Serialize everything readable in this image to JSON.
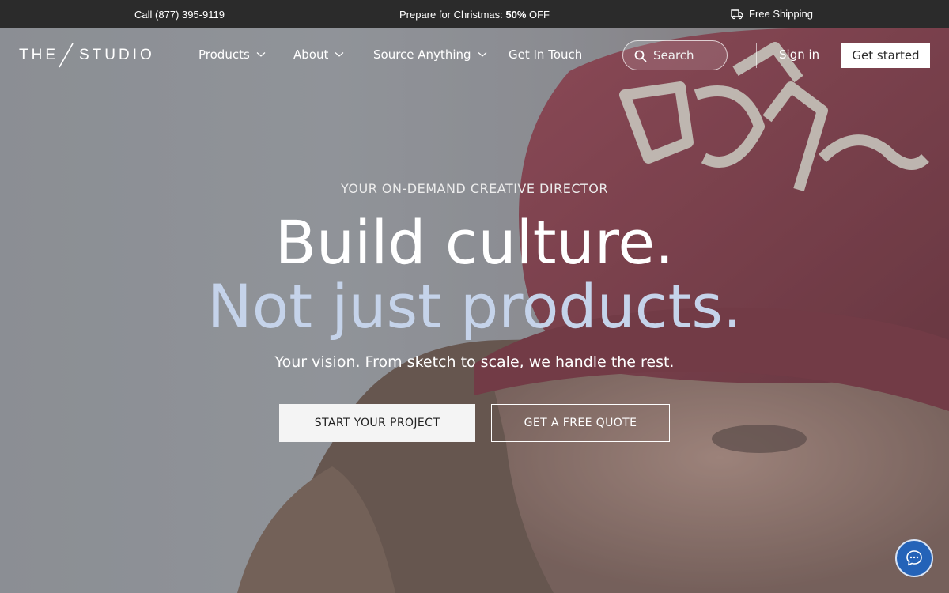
{
  "topbar": {
    "phone": "Call (877) 395-9119",
    "promo_prefix": "Prepare for Christmas: ",
    "promo_highlight": "50%",
    "promo_suffix": " OFF",
    "shipping": "Free Shipping",
    "shipping_icon": "truck-icon"
  },
  "header": {
    "logo_left": "THE",
    "logo_right": "STUDIO",
    "nav": [
      {
        "label": "Products",
        "dropdown": true
      },
      {
        "label": "About",
        "dropdown": true
      },
      {
        "label": "Source Anything",
        "dropdown": true
      },
      {
        "label": "Get In Touch",
        "dropdown": false
      }
    ],
    "search_placeholder": "Search",
    "sign_in": "Sign in",
    "get_started": "Get started"
  },
  "hero": {
    "eyebrow": "YOUR ON-DEMAND CREATIVE DIRECTOR",
    "headline_line1": "Build culture.",
    "headline_line2": "Not just products.",
    "subtitle": "Your vision. From sketch to scale, we handle the rest.",
    "cta_primary": "START YOUR PROJECT",
    "cta_secondary": "GET A FREE QUOTE"
  },
  "colors": {
    "topbar_bg": "#2b2b2b",
    "headline_accent": "#c5d3ea",
    "chat_button": "#2463b8",
    "cap": "#7a2232"
  },
  "chat": {
    "icon": "chat-bubble-icon"
  }
}
